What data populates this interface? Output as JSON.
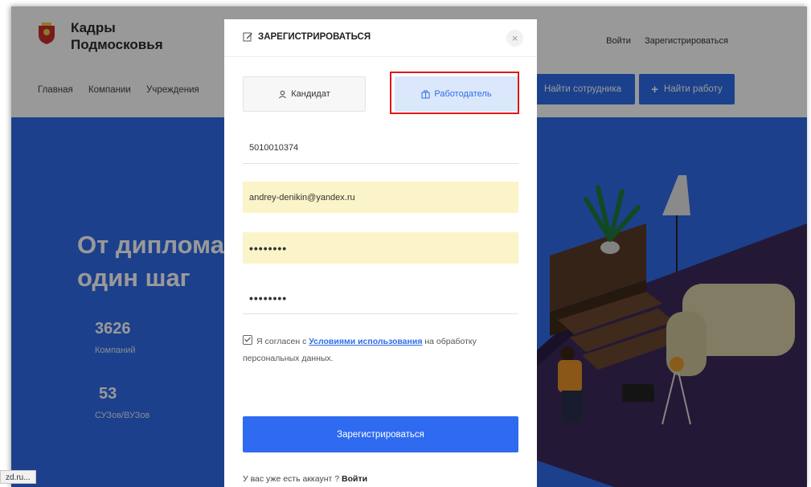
{
  "site": {
    "brand_line1": "Кадры",
    "brand_line2": "Подмосковья"
  },
  "top_links": {
    "login": "Войти",
    "register": "Зарегистрироваться"
  },
  "nav": [
    "Главная",
    "Компании",
    "Учреждения"
  ],
  "header_buttons": {
    "find_employee": "Найти сотрудника",
    "find_job": "Найти работу"
  },
  "hero": {
    "title_line1": "От диплома",
    "title_line2": "один шаг",
    "stats": [
      {
        "value": "3626",
        "label": "Компаний"
      },
      {
        "value": "53",
        "label": "СУЗов/ВУЗов"
      }
    ]
  },
  "modal": {
    "title": "ЗАРЕГИСТРИРОВАТЬСЯ",
    "close": "×",
    "roles": {
      "candidate": "Кандидат",
      "employer": "Работодатель",
      "selected": "Работодатель"
    },
    "fields": {
      "inn": "5010010374",
      "email": "andrey-denikin@yandex.ru",
      "password": "••••••••",
      "password_confirm": "••••••••"
    },
    "agreement": {
      "prefix": "Я согласен с ",
      "link": "Условиями использования",
      "suffix": " на обработку персональных данных.",
      "checked": true
    },
    "submit": "Зарегистрироваться",
    "login_prompt": "У вас уже есть аккаунт ?",
    "login_link": "Войти"
  },
  "status_bar": "zd.ru..."
}
